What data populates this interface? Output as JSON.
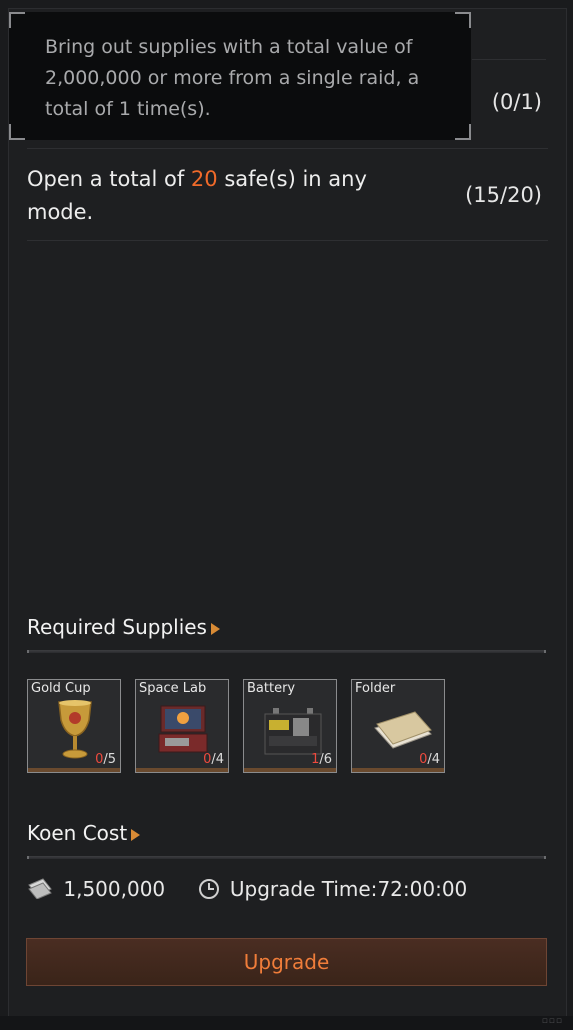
{
  "tooltip": {
    "text": "Bring out supplies with a total value of 2,000,000 or more from a single raid, a total of 1 time(s)."
  },
  "tasks": [
    {
      "progress": "(0/1)"
    },
    {
      "text_before": "Open a total of ",
      "highlight": "20",
      "text_after": " safe(s) in any mode.",
      "progress": "(15/20)"
    }
  ],
  "required_supplies": {
    "title": "Required Supplies",
    "items": [
      {
        "name": "Gold Cup",
        "have": "0",
        "need": "/5",
        "icon": "gold-cup-icon"
      },
      {
        "name": "Space Lab",
        "have": "0",
        "need": "/4",
        "icon": "space-lab-icon"
      },
      {
        "name": "Battery",
        "have": "1",
        "need": "/6",
        "icon": "battery-icon"
      },
      {
        "name": "Folder",
        "have": "0",
        "need": "/4",
        "icon": "folder-icon"
      }
    ]
  },
  "koen_cost": {
    "title": "Koen Cost",
    "amount": "1,500,000",
    "upgrade_time_label": "Upgrade Time:",
    "upgrade_time": "72:00:00"
  },
  "upgrade_button": {
    "label": "Upgrade"
  },
  "colors": {
    "highlight": "#f06a2a",
    "accent_arrow": "#d88a35",
    "button_text": "#f07d3a",
    "shortfall": "#ee4a3e"
  }
}
